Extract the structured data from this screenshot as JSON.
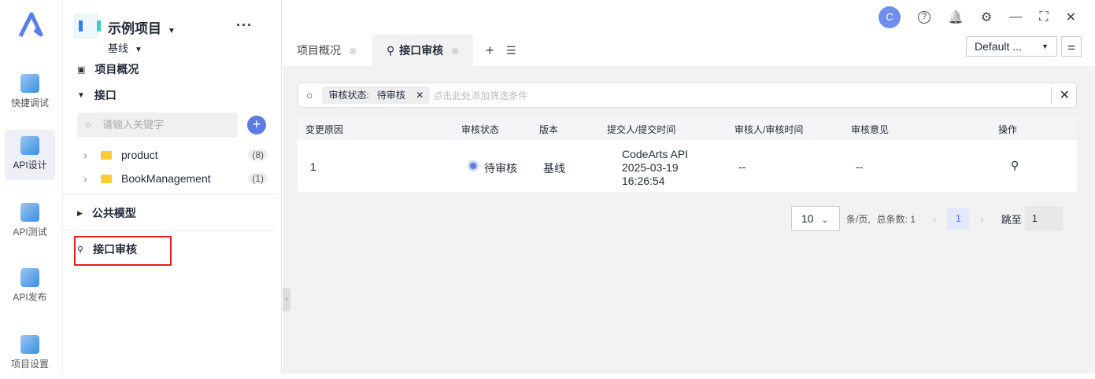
{
  "rail": [
    {
      "label": "快捷调试"
    },
    {
      "label": "API设计"
    },
    {
      "label": "API测试"
    },
    {
      "label": "API发布"
    },
    {
      "label": "项目设置"
    }
  ],
  "project": {
    "name": "示例项目",
    "more": "···",
    "version": "基线"
  },
  "nav": {
    "overview": "项目概况",
    "interfaces": "接口",
    "search_placeholder": "请输入关键字",
    "add": "+",
    "tree": [
      {
        "name": "product",
        "count": "(8)"
      },
      {
        "name": "BookManagement",
        "count": "(1)"
      }
    ],
    "models": "公共模型",
    "review": "接口审核"
  },
  "topbar": {
    "avatar": "C",
    "help": "?",
    "bell": "🔔",
    "gear": "⚙",
    "min": "—",
    "max": "⛶",
    "close": "✕"
  },
  "tabs": [
    {
      "label": "项目概况"
    },
    {
      "label": "接口审核"
    }
  ],
  "tab_add": "+",
  "tab_list": "☰",
  "env_select": "Default ...",
  "settings_icon": "⚌",
  "filter": {
    "chip_key": "审核状态:",
    "chip_value": "待审核",
    "chip_close": "✕",
    "placeholder": "点击此处添加筛选条件",
    "clear": "✕"
  },
  "table": {
    "headers": [
      "变更原因",
      "审核状态",
      "版本",
      "提交人/提交时间",
      "审核人/审核时间",
      "审核意见",
      "操作"
    ],
    "rows": [
      {
        "reason": "1",
        "status": "待审核",
        "version": "基线",
        "submitter": "CodeArts API",
        "date": "2025-03-19",
        "time": "16:26:54",
        "reviewer": "--",
        "comment": "--"
      }
    ]
  },
  "pager": {
    "size": "10",
    "per_page": "条/页,",
    "total": "总条数: 1",
    "prev": "‹",
    "page": "1",
    "next": "›",
    "jump": "跳至",
    "jump_value": "1"
  }
}
